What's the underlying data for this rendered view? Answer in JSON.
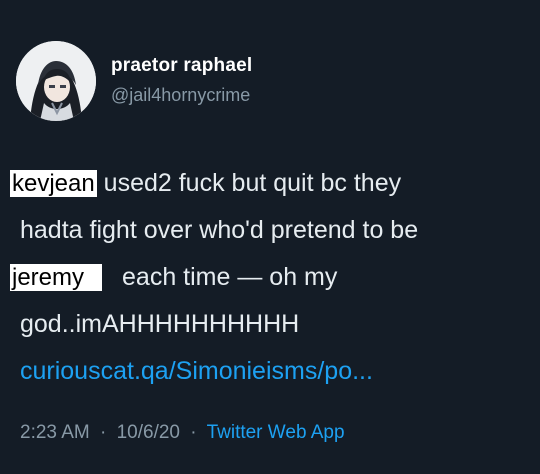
{
  "author": {
    "display_name": "praetor raphael",
    "handle": "@jail4hornycrime",
    "avatar_icon": "anime-avatar-icon"
  },
  "tweet": {
    "lines": [
      {
        "patch": "kevjean",
        "text": " used2 fuck but quit bc they"
      },
      {
        "patch": "",
        "text": "hadta fight over who'd pretend to be"
      },
      {
        "patch": "jeremy",
        "text": "each time — oh my"
      },
      {
        "patch": "",
        "text": "god..imAHHHHHHHHHH"
      }
    ],
    "link": "curiouscat.qa/Simonieisms/po..."
  },
  "meta": {
    "time": "2:23 AM",
    "separator": "·",
    "date": "10/6/20",
    "source": "Twitter Web App"
  },
  "colors": {
    "background": "#141c26",
    "link": "#1da1f2",
    "secondary": "#8899a6"
  }
}
